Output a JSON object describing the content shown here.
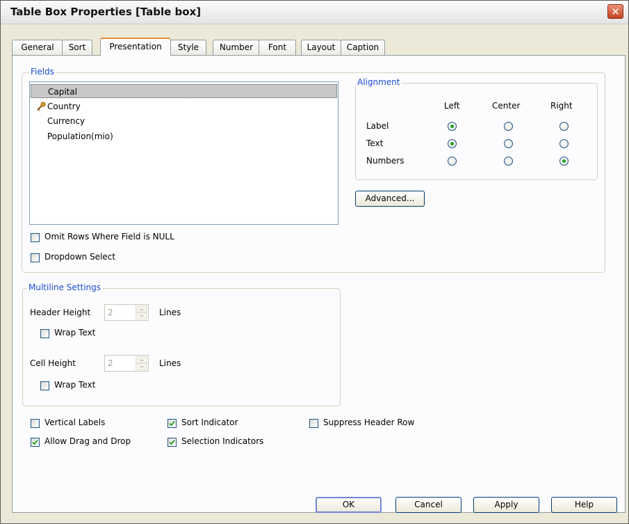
{
  "window": {
    "title": "Table Box Properties [Table box]",
    "close_glyph": "✕"
  },
  "tabs": [
    {
      "label": "General"
    },
    {
      "label": "Sort"
    },
    {
      "label": "Presentation"
    },
    {
      "label": "Style"
    },
    {
      "label": "Number"
    },
    {
      "label": "Font"
    },
    {
      "label": "Layout"
    },
    {
      "label": "Caption"
    }
  ],
  "active_tab": "Presentation",
  "fields": {
    "legend": "Fields",
    "items": [
      {
        "label": "Capital",
        "selected": true,
        "key": false
      },
      {
        "label": "Country",
        "selected": false,
        "key": true
      },
      {
        "label": "Currency",
        "selected": false,
        "key": false
      },
      {
        "label": "Population(mio)",
        "selected": false,
        "key": false
      }
    ],
    "omit_nulls": {
      "label": "Omit Rows Where Field is NULL",
      "checked": false
    },
    "dropdown_select": {
      "label": "Dropdown Select",
      "checked": false
    }
  },
  "alignment": {
    "legend": "Alignment",
    "columns": [
      "Left",
      "Center",
      "Right"
    ],
    "rows": [
      {
        "label": "Label",
        "selected": "Left"
      },
      {
        "label": "Text",
        "selected": "Left"
      },
      {
        "label": "Numbers",
        "selected": "Right"
      }
    ],
    "advanced_label": "Advanced..."
  },
  "multiline": {
    "legend": "Multiline Settings",
    "header_height": {
      "label": "Header Height",
      "value": "2",
      "unit": "Lines",
      "wrap_label": "Wrap Text",
      "wrap_checked": false
    },
    "cell_height": {
      "label": "Cell Height",
      "value": "2",
      "unit": "Lines",
      "wrap_label": "Wrap Text",
      "wrap_checked": false
    }
  },
  "options": {
    "vertical_labels": {
      "label": "Vertical Labels",
      "checked": false
    },
    "allow_drag_drop": {
      "label": "Allow Drag and Drop",
      "checked": true
    },
    "sort_indicator": {
      "label": "Sort Indicator",
      "checked": true
    },
    "selection_indicators": {
      "label": "Selection Indicators",
      "checked": true
    },
    "suppress_header_row": {
      "label": "Suppress Header Row",
      "checked": false
    }
  },
  "buttons": {
    "ok": "OK",
    "cancel": "Cancel",
    "apply": "Apply",
    "help": "Help"
  },
  "colors": {
    "legend_blue": "#1b4bd1",
    "radio_dot": "#21a121",
    "check_mark": "#21a121",
    "tab_accent": "#e68b2c",
    "close_red": "#c4411e"
  }
}
